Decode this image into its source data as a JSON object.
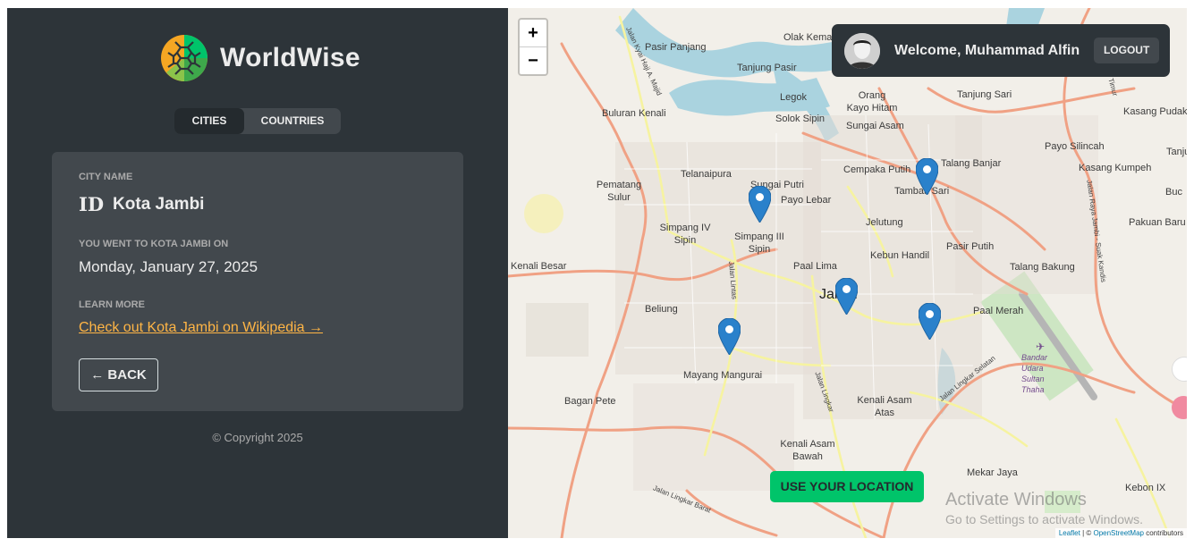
{
  "app": {
    "name": "WorldWise",
    "tabs": [
      {
        "label": "Cities"
      },
      {
        "label": "Countries"
      }
    ]
  },
  "city_details": {
    "city_name_label": "City name",
    "flag_code": "ID",
    "city_name": "Kota Jambi",
    "visited_label": "You went to Kota Jambi on",
    "visited_date": "Monday, January 27, 2025",
    "learn_more_label": "Learn more",
    "wiki_link": "Check out Kota Jambi on Wikipedia →",
    "back_label": "← BACK"
  },
  "footer": {
    "copyright": "© Copyright 2025"
  },
  "user": {
    "welcome": "Welcome, Muhammad Alfin",
    "logout_label": "LOGOUT"
  },
  "map": {
    "zoom_in": "+",
    "zoom_out": "−",
    "use_location_label": "Use your location",
    "places": [
      "Olak Kemang",
      "Pasir Panjang",
      "Tanjung Pasir",
      "Buluran Kenali",
      "Legok",
      "Solok Sipin",
      "Orang Kayo Hitam",
      "Sungai Asam",
      "Tanjung Sari",
      "Kasang Pudak",
      "Payo Silincah",
      "Kasang Kumpeh",
      "Tanjung",
      "Pematang Sulur",
      "Telanaipura",
      "Sungai Putri",
      "Payo Lebar",
      "Cempaka Putih",
      "Tambak Sari",
      "Talang Banjar",
      "Simpang IV Sipin",
      "Simpang III Sipin",
      "Jelutung",
      "Pasir Putih",
      "Pakuan Baru",
      "Kenali Besar",
      "Paal Lima",
      "Kebun Handil",
      "Talang Bakung",
      "Jambi",
      "Beliung",
      "Paal Merah",
      "Mayang Mangurai",
      "Bandar Udara Sultan Thaha",
      "Bagan Pete",
      "Kenali Asam Atas",
      "Kenali Asam Bawah",
      "Mekar Jaya",
      "Kebon IX",
      "Buc"
    ],
    "road_labels": [
      "Jalan Kyai Haji A. Majid",
      "Jalan Lingkar Barat",
      "Jalan Lingkar Selatan",
      "Jalan Lingkar Timur",
      "Jalan Raya Jambi - Suak Kandis",
      "Jalan Lintas",
      "Jalan Lingkar"
    ],
    "markers": 5,
    "attribution": {
      "leaflet": "Leaflet",
      "separator": " | © ",
      "osm": "OpenStreetMap",
      "suffix": " contributors"
    },
    "watermark": {
      "title": "Activate Windows",
      "subtitle": "Go to Settings to activate Windows."
    }
  },
  "colors": {
    "sidebar_bg": "#2d3439",
    "panel_bg": "#42484d",
    "brand_green": "#00c46a",
    "brand_orange": "#ffb545",
    "text_light": "#ececec"
  }
}
